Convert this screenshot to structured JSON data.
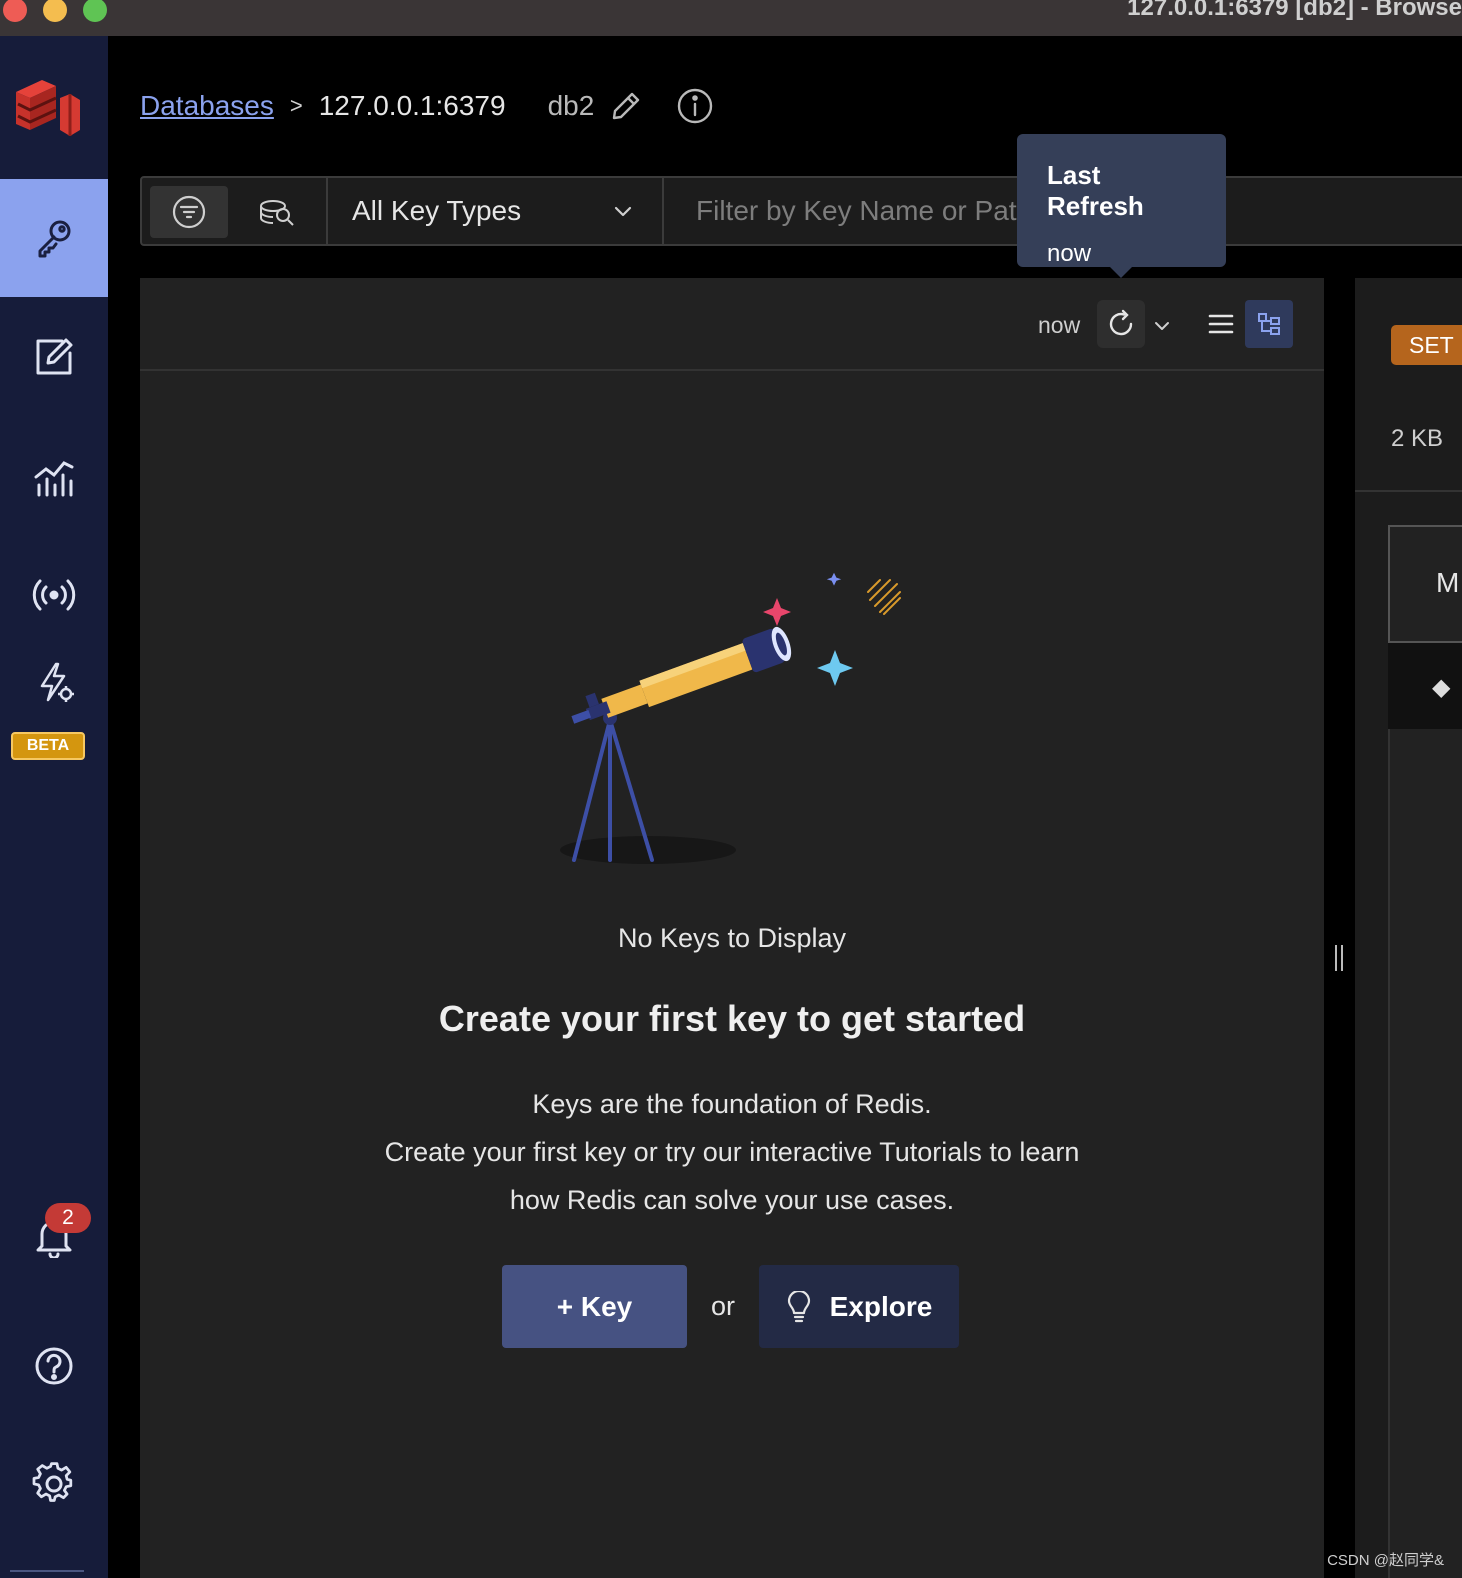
{
  "window": {
    "title": "127.0.0.1:6379 [db2] - Browse"
  },
  "sidebar": {
    "items": [
      {
        "name": "browser",
        "icon": "key-icon",
        "active": true
      },
      {
        "name": "workbench",
        "icon": "edit-icon"
      },
      {
        "name": "analytics",
        "icon": "analytics-icon"
      },
      {
        "name": "pubsub",
        "icon": "broadcast-icon"
      },
      {
        "name": "triggers",
        "icon": "lightning-icon",
        "badge": "BETA"
      }
    ],
    "notifications": {
      "icon": "bell-icon",
      "count": "2"
    },
    "help_icon": "help-icon",
    "settings_icon": "gear-icon"
  },
  "breadcrumb": {
    "databases": "Databases",
    "separator": ">",
    "host": "127.0.0.1:6379",
    "db": "db2"
  },
  "filter": {
    "key_type": "All Key Types",
    "search_placeholder": "Filter by Key Name or Pattern"
  },
  "tooltip": {
    "title": "Last Refresh",
    "value": "now"
  },
  "toolbar": {
    "refresh_label": "now"
  },
  "empty_state": {
    "title": "No Keys to Display",
    "heading": "Create your first key to get started",
    "lines": [
      "Keys are the foundation of Redis.",
      "Create your first key or try our interactive Tutorials to learn",
      "how Redis can solve your use cases."
    ],
    "add_key_label": "+ Key",
    "or_label": "or",
    "explore_label": "Explore"
  },
  "details": {
    "type_badge": "SET",
    "size": "2 KB",
    "box_letter": "M",
    "row_icon": "◆"
  },
  "watermark": "CSDN @赵同学&",
  "colors": {
    "sidebar_bg": "#161c3a",
    "accent": "#8ba2ee",
    "button_primary": "#465282",
    "set_badge": "#b5651d",
    "beta_badge": "#d4960f",
    "notification": "#c43a36"
  }
}
